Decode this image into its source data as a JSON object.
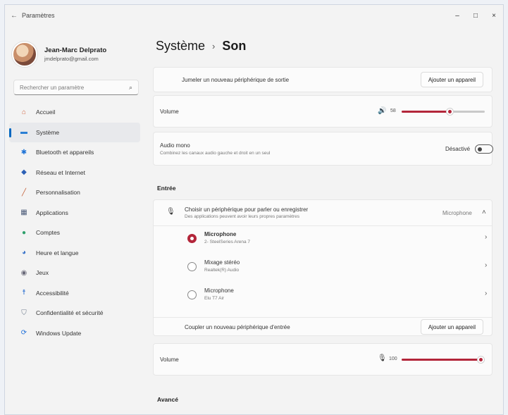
{
  "window": {
    "title": "Paramètres",
    "controls": {
      "minimize": "–",
      "maximize": "□",
      "close": "×"
    },
    "back": "←"
  },
  "profile": {
    "name": "Jean-Marc Delprato",
    "email": "jmdelprato@gmail.com"
  },
  "search": {
    "placeholder": "Rechercher un paramètre"
  },
  "nav": [
    {
      "label": "Accueil",
      "icon": "home-icon",
      "color": "#d1633f"
    },
    {
      "label": "Système",
      "icon": "system-icon",
      "color": "#2b7fd4",
      "active": true
    },
    {
      "label": "Bluetooth et appareils",
      "icon": "bluetooth-icon",
      "color": "#1e73d6"
    },
    {
      "label": "Réseau et Internet",
      "icon": "network-icon",
      "color": "#2b5fb5"
    },
    {
      "label": "Personnalisation",
      "icon": "brush-icon",
      "color": "#c4613a"
    },
    {
      "label": "Applications",
      "icon": "apps-icon",
      "color": "#4a5a78"
    },
    {
      "label": "Comptes",
      "icon": "accounts-icon",
      "color": "#2ea06b"
    },
    {
      "label": "Heure et langue",
      "icon": "globe-clock-icon",
      "color": "#3b74c9"
    },
    {
      "label": "Jeux",
      "icon": "gamepad-icon",
      "color": "#6b6b7a"
    },
    {
      "label": "Accessibilité",
      "icon": "accessibility-icon",
      "color": "#2a6fd1"
    },
    {
      "label": "Confidentialité et sécurité",
      "icon": "shield-icon",
      "color": "#6c7a8c"
    },
    {
      "label": "Windows Update",
      "icon": "update-icon",
      "color": "#1e6fd9"
    }
  ],
  "breadcrumb": {
    "parent": "Système",
    "separator": "›",
    "current": "Son"
  },
  "output": {
    "pair_label": "Jumeler un nouveau périphérique de sortie",
    "pair_button": "Ajouter un appareil",
    "volume_label": "Volume",
    "volume_value": "58",
    "volume_fraction": 0.58,
    "mono_label": "Audio mono",
    "mono_desc": "Combinez les canaux audio gauche et droit en un seul",
    "mono_state": "Désactivé"
  },
  "input": {
    "section": "Entrée",
    "choose_label": "Choisir un périphérique pour parler ou enregistrer",
    "choose_desc": "Des applications peuvent avoir leurs propres paramètres",
    "choose_value": "Microphone",
    "devices": [
      {
        "name": "Microphone",
        "desc": "2- SteelSeries Arena 7",
        "selected": true
      },
      {
        "name": "Mixage stéréo",
        "desc": "Realtek(R) Audio",
        "selected": false
      },
      {
        "name": "Microphone",
        "desc": "Elu T7 Air",
        "selected": false
      }
    ],
    "pair_label": "Coupler un nouveau périphérique d'entrée",
    "pair_button": "Ajouter un appareil",
    "volume_label": "Volume",
    "volume_value": "100",
    "volume_fraction": 1.0
  },
  "advanced": {
    "section": "Avancé"
  },
  "colors": {
    "accent": "#b3263a",
    "nav_indicator": "#0067c0"
  }
}
